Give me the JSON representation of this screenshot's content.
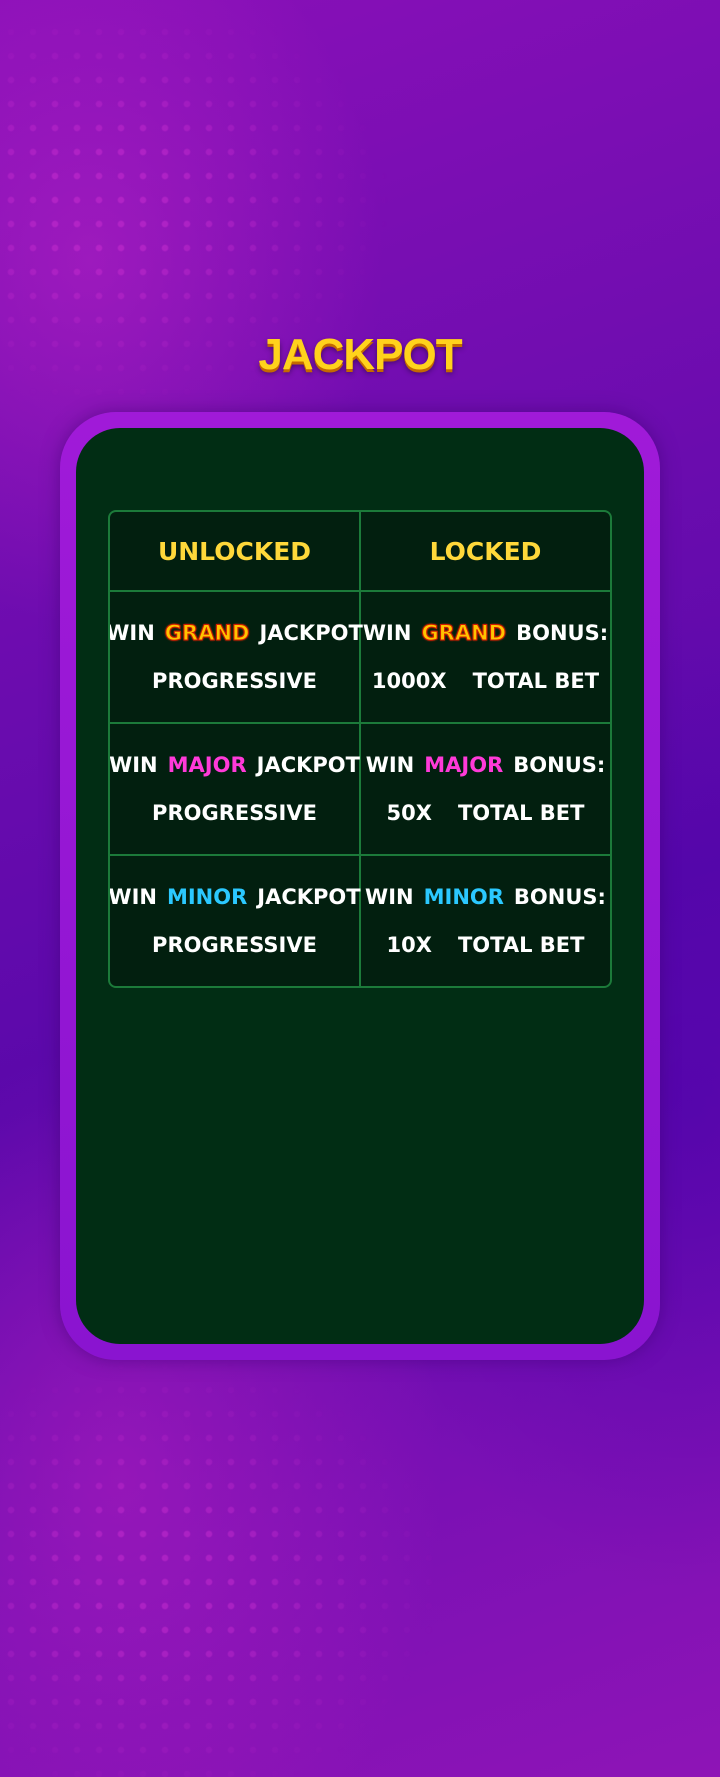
{
  "title": "JACKPOT",
  "columns": {
    "unlocked": "UNLOCKED",
    "locked": "LOCKED"
  },
  "rows": [
    {
      "unlocked": {
        "win": "WIN",
        "tier": "GRAND",
        "suffix": "JACKPOT",
        "line2": "PROGRESSIVE"
      },
      "locked": {
        "win": "WIN",
        "tier": "GRAND",
        "suffix": "BONUS:",
        "multiplier": "1000X",
        "total_bet": "TOTAL BET"
      }
    },
    {
      "unlocked": {
        "win": "WIN",
        "tier": "MAJOR",
        "suffix": "JACKPOT",
        "line2": "PROGRESSIVE"
      },
      "locked": {
        "win": "WIN",
        "tier": "MAJOR",
        "suffix": "BONUS:",
        "multiplier": "50X",
        "total_bet": "TOTAL BET"
      }
    },
    {
      "unlocked": {
        "win": "WIN",
        "tier": "MINOR",
        "suffix": "JACKPOT",
        "line2": "PROGRESSIVE"
      },
      "locked": {
        "win": "WIN",
        "tier": "MINOR",
        "suffix": "BONUS:",
        "multiplier": "10X",
        "total_bet": "TOTAL BET"
      }
    }
  ],
  "colors": {
    "title": "#ffd21c",
    "header_text": "#ffd83a",
    "grand": "#ffc400",
    "major": "#ff3ad8",
    "minor": "#2bc8ff",
    "panel_bg": "#012d14",
    "panel_frame": "#a01ad8",
    "grid_lines": "#1c7a3a"
  }
}
